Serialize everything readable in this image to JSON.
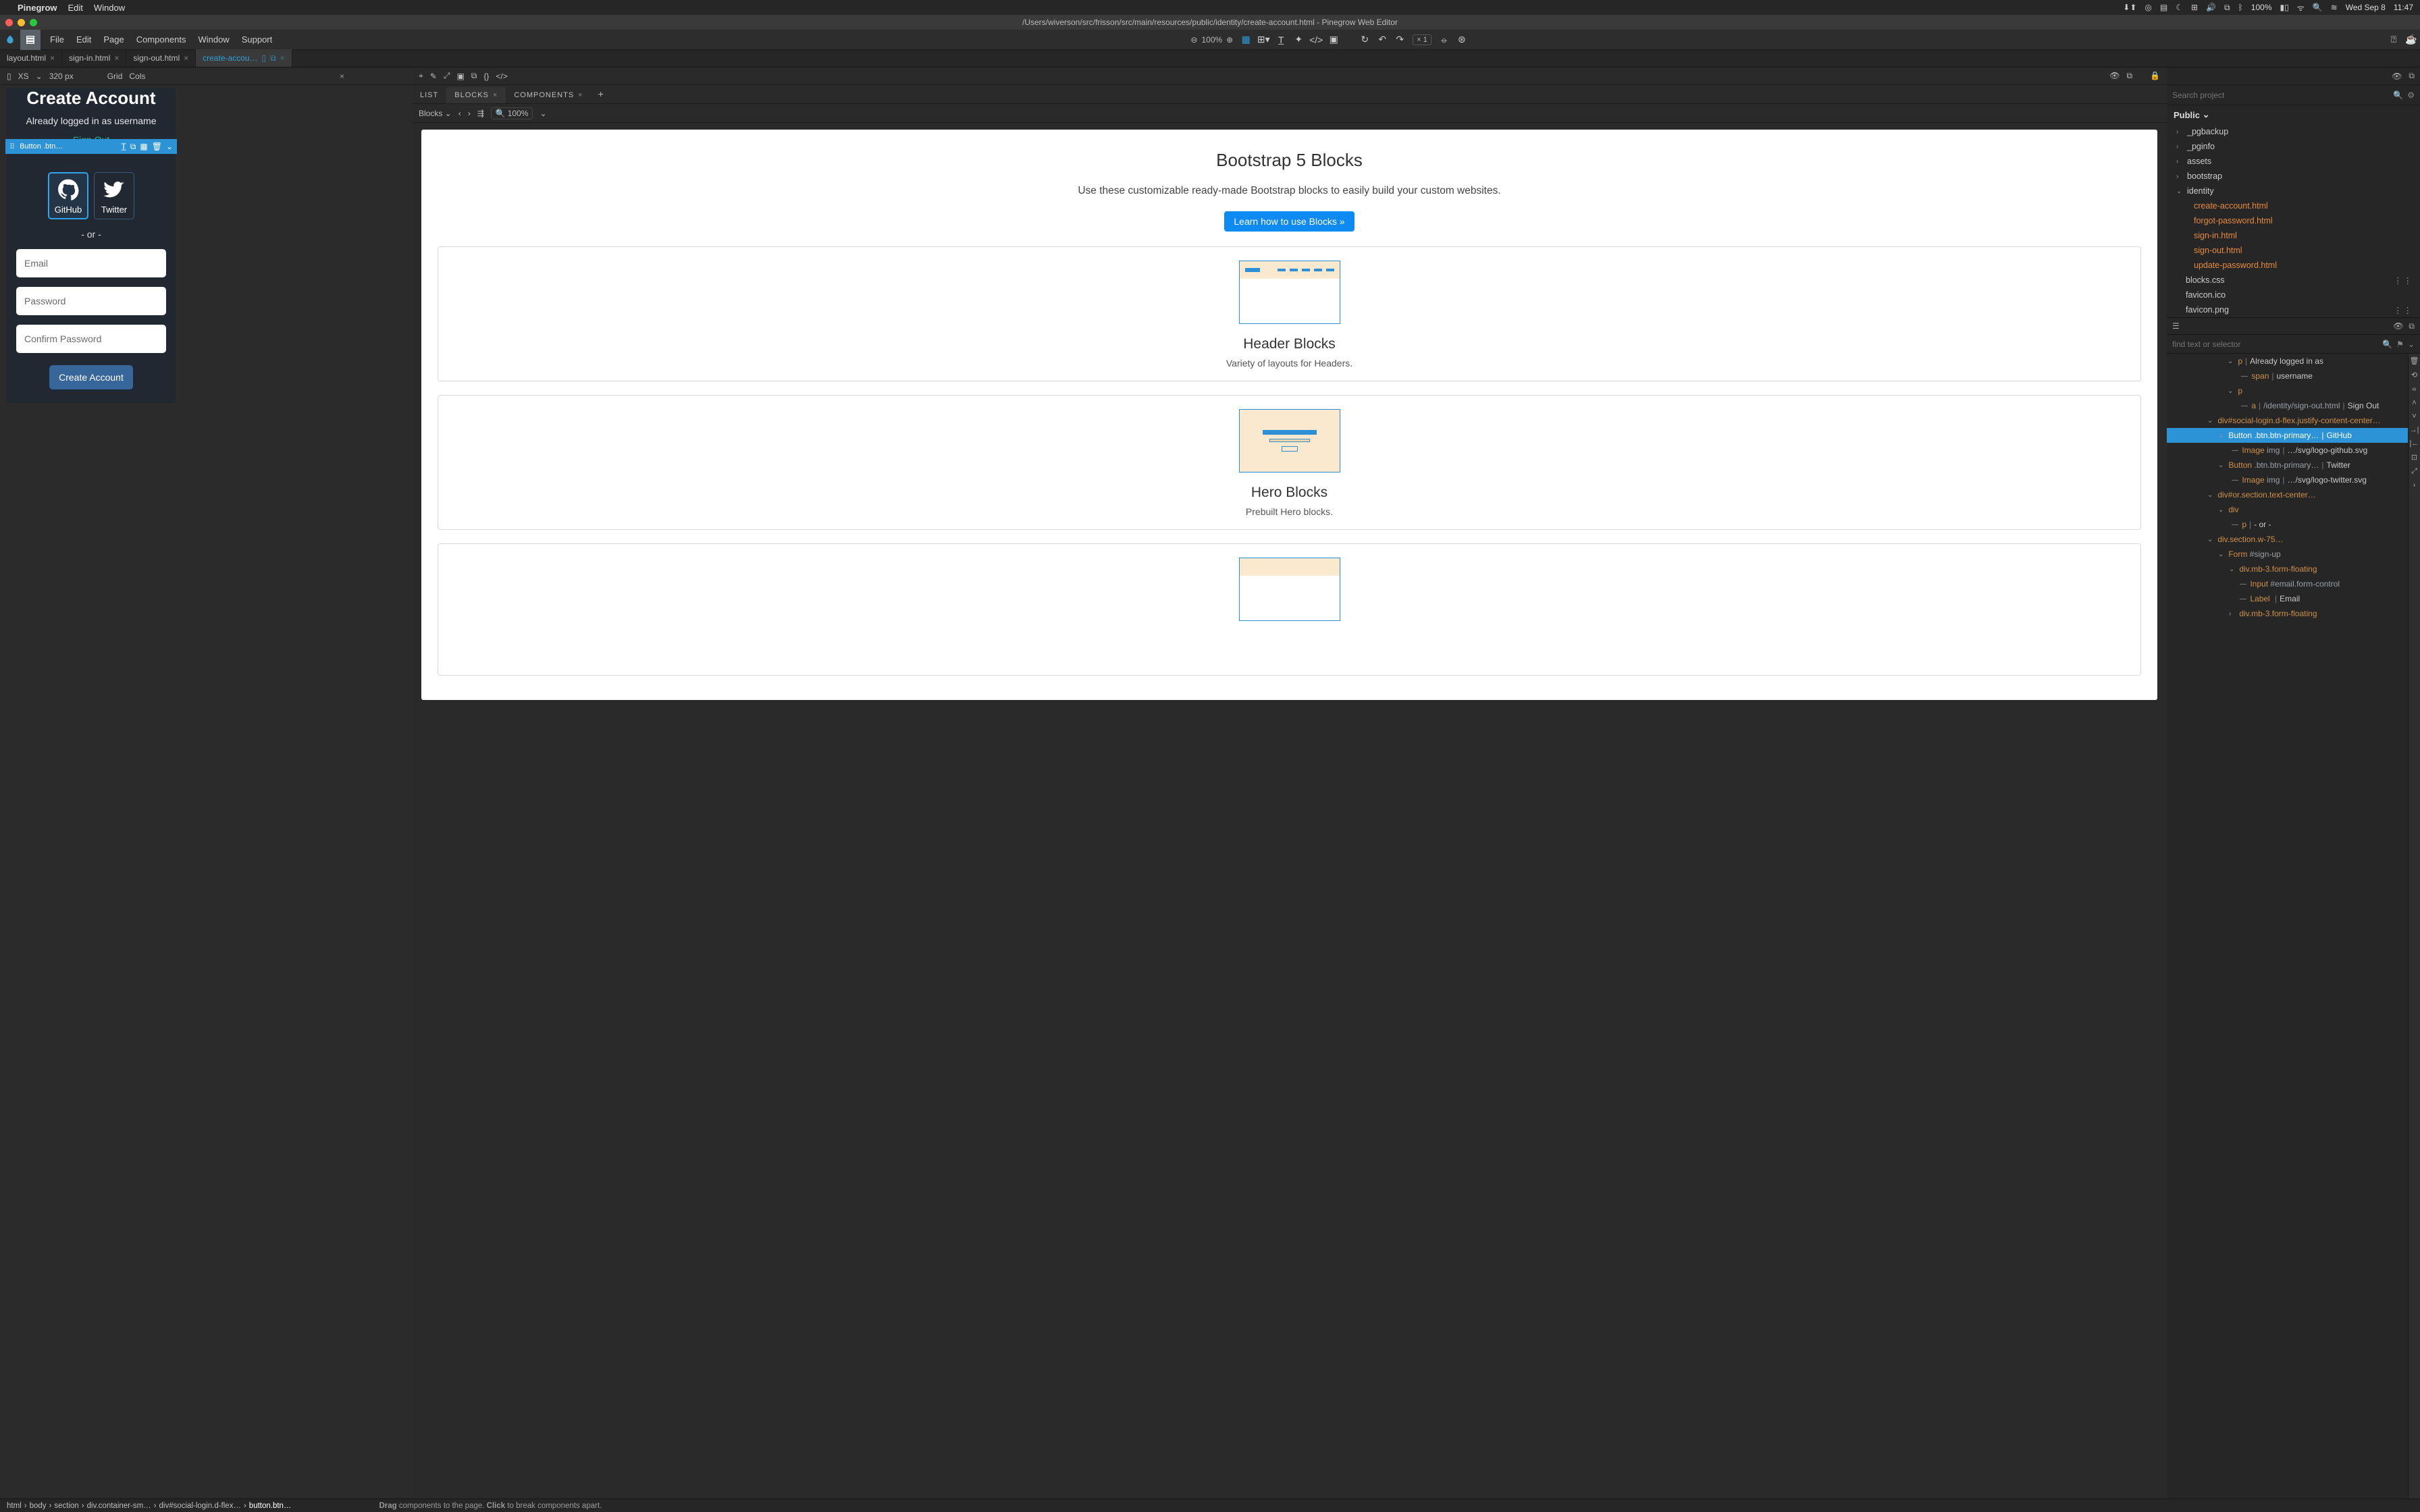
{
  "mac": {
    "app": "Pinegrow",
    "menus": [
      "Edit",
      "Window"
    ],
    "battery": "100%",
    "date": "Wed Sep 8",
    "time": "11:47"
  },
  "titlebar": {
    "path": "/Users/wiverson/src/frisson/src/main/resources/public/identity/create-account.html - Pinegrow Web Editor"
  },
  "app_menu": [
    "File",
    "Edit",
    "Page",
    "Components",
    "Window",
    "Support"
  ],
  "app_zoom": "100%",
  "app_scale": "× 1",
  "tabs": [
    {
      "label": "layout.html",
      "active": false
    },
    {
      "label": "sign-in.html",
      "active": false
    },
    {
      "label": "sign-out.html",
      "active": false
    },
    {
      "label": "create-accou…",
      "active": true
    }
  ],
  "device": {
    "size_label": "XS",
    "px": "320 px",
    "toggles": [
      "Grid",
      "Cols"
    ]
  },
  "page": {
    "title": "Create Account",
    "logged_in": "Already logged in as username",
    "signout": "Sign Out",
    "selected_element": "Button .btn…",
    "social": [
      {
        "name": "GitHub"
      },
      {
        "name": "Twitter"
      }
    ],
    "or": "- or -",
    "fields": {
      "email": "Email",
      "password": "Password",
      "confirm": "Confirm Password"
    },
    "submit": "Create Account"
  },
  "mid_tabs": {
    "list": "LIST",
    "blocks": "BLOCKS",
    "components": "COMPONENTS"
  },
  "mid_sub": {
    "blocks": "Blocks",
    "zoom": "100%"
  },
  "blocks": {
    "title": "Bootstrap 5 Blocks",
    "desc": "Use these customizable ready-made Bootstrap blocks to easily build your custom websites.",
    "cta": "Learn how to use Blocks »",
    "cards": [
      {
        "title": "Header Blocks",
        "sub": "Variety of layouts for Headers."
      },
      {
        "title": "Hero Blocks",
        "sub": "Prebuilt Hero blocks."
      }
    ]
  },
  "search_placeholder": "Search project",
  "public_label": "Public",
  "project_tree": {
    "folders": [
      "_pgbackup",
      "_pginfo",
      "assets",
      "bootstrap"
    ],
    "identity": "identity",
    "identity_files": [
      "create-account.html",
      "forgot-password.html",
      "sign-in.html",
      "sign-out.html",
      "update-password.html"
    ],
    "root_files": [
      "blocks.css",
      "favicon.ico",
      "favicon.png"
    ]
  },
  "find_placeholder": "find text or selector",
  "dom": {
    "r1": {
      "tag": "p",
      "txt": "Already logged in as"
    },
    "r2": {
      "tag": "span",
      "txt": "username"
    },
    "r3": {
      "tag": "p"
    },
    "r4": {
      "tag": "a",
      "cls": "/identity/sign-out.html",
      "txt": "Sign Out"
    },
    "r5": {
      "tag": "div#social-login.d-flex.justify-content-center…"
    },
    "r6": {
      "tag": "Button",
      "cls": ".btn.btn-primary…",
      "txt": "GitHub"
    },
    "r7": {
      "tag": "Image",
      "cls": "img",
      "txt": "…/svg/logo-github.svg"
    },
    "r8": {
      "tag": "Button",
      "cls": ".btn.btn-primary…",
      "txt": "Twitter"
    },
    "r9": {
      "tag": "Image",
      "cls": "img",
      "txt": "…/svg/logo-twitter.svg"
    },
    "r10": {
      "tag": "div#or.section.text-center…"
    },
    "r11": {
      "tag": "div"
    },
    "r12": {
      "tag": "p",
      "txt": "- or -"
    },
    "r13": {
      "tag": "div.section.w-75…"
    },
    "r14": {
      "tag": "Form",
      "cls": "#sign-up"
    },
    "r15": {
      "tag": "div.mb-3.form-floating"
    },
    "r16": {
      "tag": "Input",
      "cls": "#email.form-control"
    },
    "r17": {
      "tag": "Label",
      "txt": "Email"
    },
    "r18": {
      "tag": "div.mb-3.form-floating"
    }
  },
  "breadcrumbs": [
    "html",
    "body",
    "section",
    "div.container-sm…",
    "div#social-login.d-flex…",
    "button.btn…"
  ],
  "footer_hint_a": "Drag",
  "footer_hint_b": " components to the page. ",
  "footer_hint_c": "Click",
  "footer_hint_d": " to break components apart."
}
